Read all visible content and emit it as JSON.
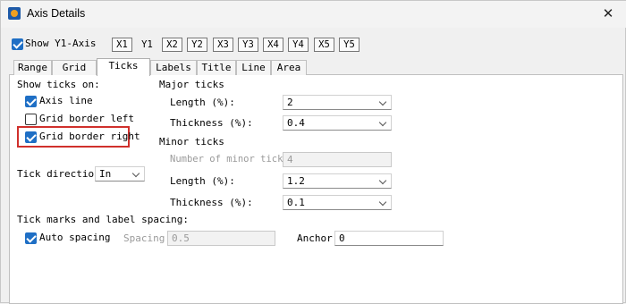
{
  "window": {
    "title": "Axis Details",
    "close_glyph": "✕"
  },
  "axes_row": {
    "show_label": "Show Y1-Axis",
    "show_checked": true,
    "buttons": [
      "X1",
      "Y1",
      "X2",
      "Y2",
      "X3",
      "Y3",
      "X4",
      "Y4",
      "X5",
      "Y5"
    ]
  },
  "tabs": [
    "Range",
    "Grid",
    "Ticks",
    "Labels",
    "Title",
    "Line",
    "Area"
  ],
  "active_tab": "Ticks",
  "show_ticks": {
    "heading": "Show ticks on:",
    "axis_line": {
      "label": "Axis line",
      "checked": true
    },
    "grid_left": {
      "label": "Grid border left",
      "checked": false
    },
    "grid_right": {
      "label": "Grid border right",
      "checked": true
    }
  },
  "tick_direction": {
    "label": "Tick direction:",
    "value": "In"
  },
  "major": {
    "heading": "Major ticks",
    "length_label": "Length (%):",
    "length_value": "2",
    "thickness_label": "Thickness (%):",
    "thickness_value": "0.4"
  },
  "minor": {
    "heading": "Minor ticks",
    "number_label": "Number of minor ticks:",
    "number_value": "4",
    "length_label": "Length (%):",
    "length_value": "1.2",
    "thickness_label": "Thickness (%):",
    "thickness_value": "0.1"
  },
  "spacing": {
    "heading": "Tick marks and label spacing:",
    "auto_label": "Auto spacing",
    "auto_checked": true,
    "spacing_label": "Spacing:",
    "spacing_value": "0.5",
    "anchor_label": "Anchor:",
    "anchor_value": "0"
  },
  "colors": {
    "accent": "#1f6fc5",
    "highlight": "#d0302c"
  }
}
